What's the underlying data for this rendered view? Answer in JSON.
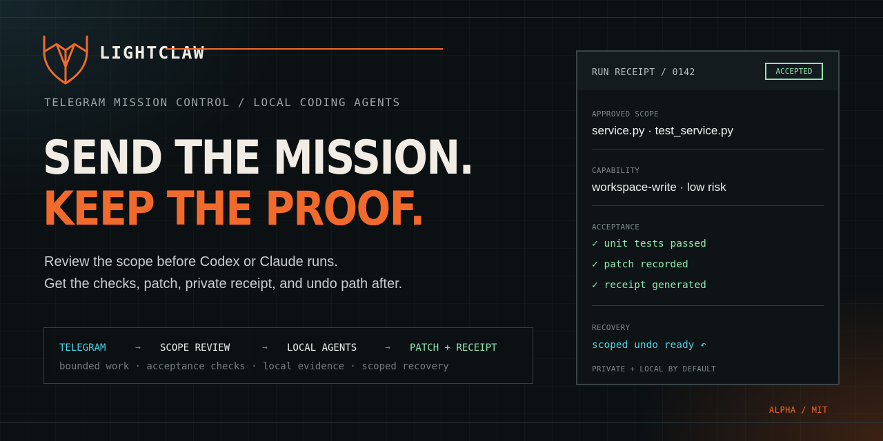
{
  "brand": {
    "name": "LIGHTCLAW",
    "tagline": "TELEGRAM MISSION CONTROL / LOCAL CODING AGENTS"
  },
  "hero": {
    "line1": "SEND THE MISSION.",
    "line2": "KEEP THE PROOF.",
    "description": [
      "Review the scope before Codex or Claude runs.",
      "Get the checks, patch, private receipt, and undo path after."
    ]
  },
  "flow": {
    "steps": [
      "TELEGRAM",
      "SCOPE REVIEW",
      "LOCAL AGENTS",
      "PATCH + RECEIPT"
    ],
    "arrow": "→",
    "subtitle": "bounded work · acceptance checks · local evidence · scoped recovery"
  },
  "receipt": {
    "title": "RUN RECEIPT / 0142",
    "status": "ACCEPTED",
    "scope_label": "APPROVED SCOPE",
    "scope_value": "service.py · test_service.py",
    "capability_label": "CAPABILITY",
    "capability_value": "workspace-write · low risk",
    "acceptance_label": "ACCEPTANCE",
    "checks": [
      "✓ unit tests passed",
      "✓ patch recorded",
      "✓ receipt generated"
    ],
    "recovery_label": "RECOVERY",
    "recovery_value": "scoped undo ready ↶",
    "footer": "PRIVATE + LOCAL BY DEFAULT"
  },
  "license": "ALPHA / MIT",
  "colors": {
    "background": "#0b1013",
    "accent": "#f26a2b",
    "text": "#f1ece4",
    "success": "#8ee6b0",
    "info": "#4fd2e6"
  }
}
